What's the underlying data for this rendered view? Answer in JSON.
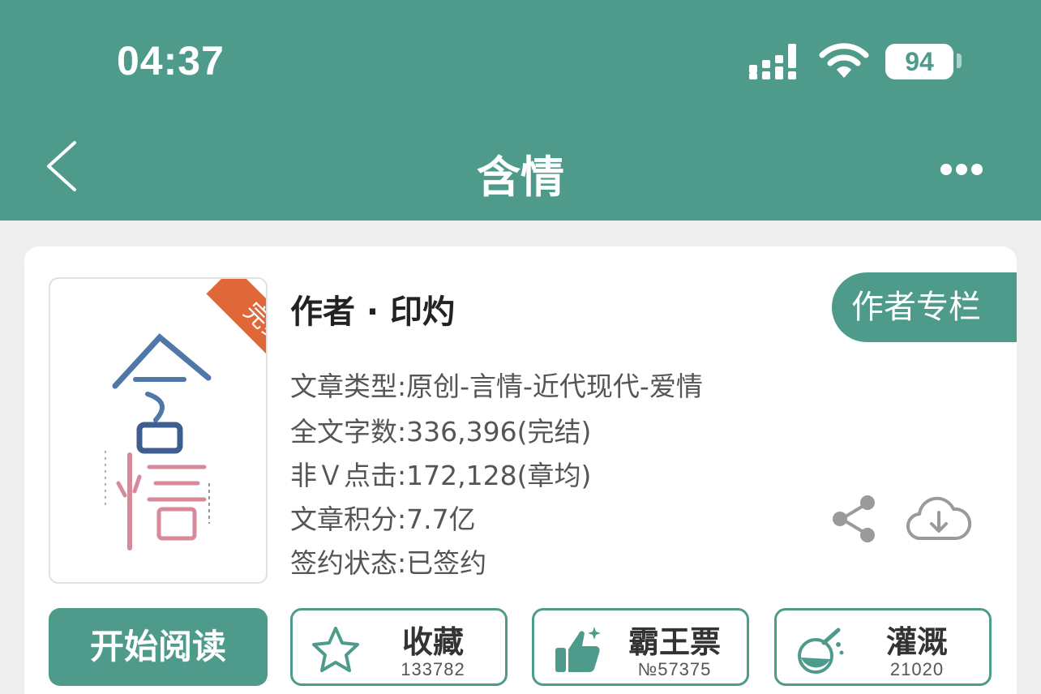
{
  "status_bar": {
    "time": "04:37",
    "battery": "94"
  },
  "nav": {
    "title": "含情"
  },
  "book": {
    "badge": "完结",
    "author_line": "作者 · 印灼",
    "author_column_btn": "作者专栏",
    "info": [
      "文章类型:原创-言情-近代现代-爱情",
      "全文字数:336,396(完结)",
      "非Ｖ点击:172,128(章均)",
      "文章积分:7.7亿",
      "签约状态:已签约"
    ]
  },
  "actions": {
    "read": "开始阅读",
    "favorite": {
      "label": "收藏",
      "count": "133782"
    },
    "overlord_ticket": {
      "label": "霸王票",
      "count": "№57375"
    },
    "nutrient": {
      "label": "灌溉",
      "count": "21020"
    }
  },
  "colors": {
    "brand": "#4e9b8c",
    "badge": "#e06838",
    "background": "#eeeeee"
  },
  "icons": [
    "chevron-left-icon",
    "more-icon",
    "share-icon",
    "cloud-download-icon",
    "star-icon",
    "thumbs-up-icon",
    "watering-flask-icon",
    "signal-icon",
    "wifi-icon",
    "battery-icon"
  ]
}
